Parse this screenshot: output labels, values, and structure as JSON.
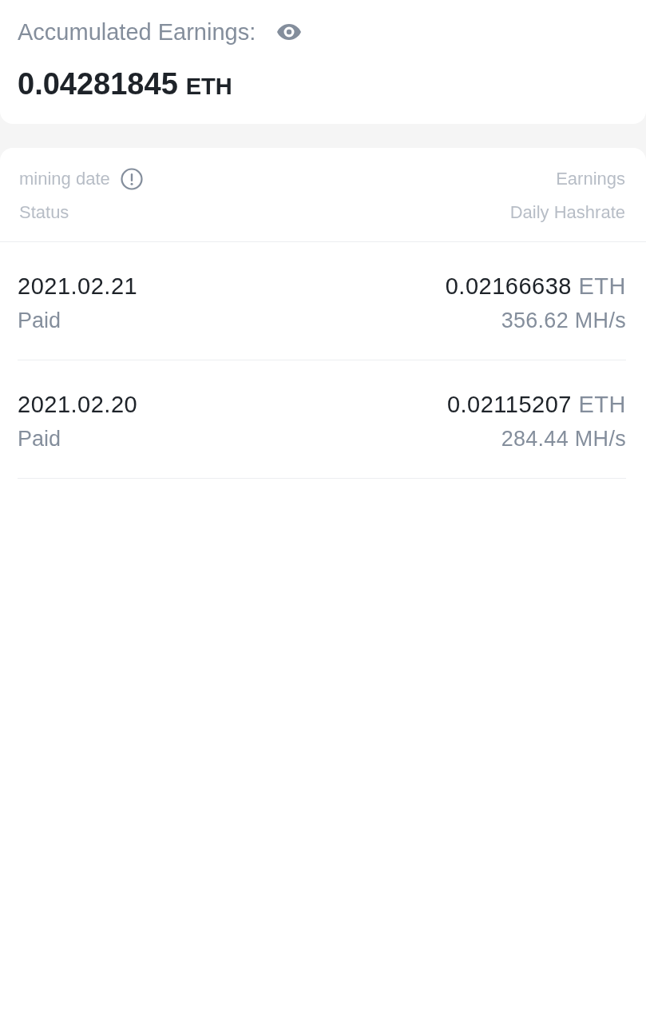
{
  "summary": {
    "label": "Accumulated Earnings:",
    "amount": "0.04281845",
    "unit": "ETH"
  },
  "table": {
    "columns": {
      "date": "mining date",
      "status": "Status",
      "earnings": "Earnings",
      "hashrate": "Daily Hashrate"
    },
    "rows": [
      {
        "date": "2021.02.21",
        "status": "Paid",
        "earnings": "0.02166638",
        "unit": "ETH",
        "hashrate": "356.62 MH/s"
      },
      {
        "date": "2021.02.20",
        "status": "Paid",
        "earnings": "0.02115207",
        "unit": "ETH",
        "hashrate": "284.44 MH/s"
      }
    ]
  }
}
